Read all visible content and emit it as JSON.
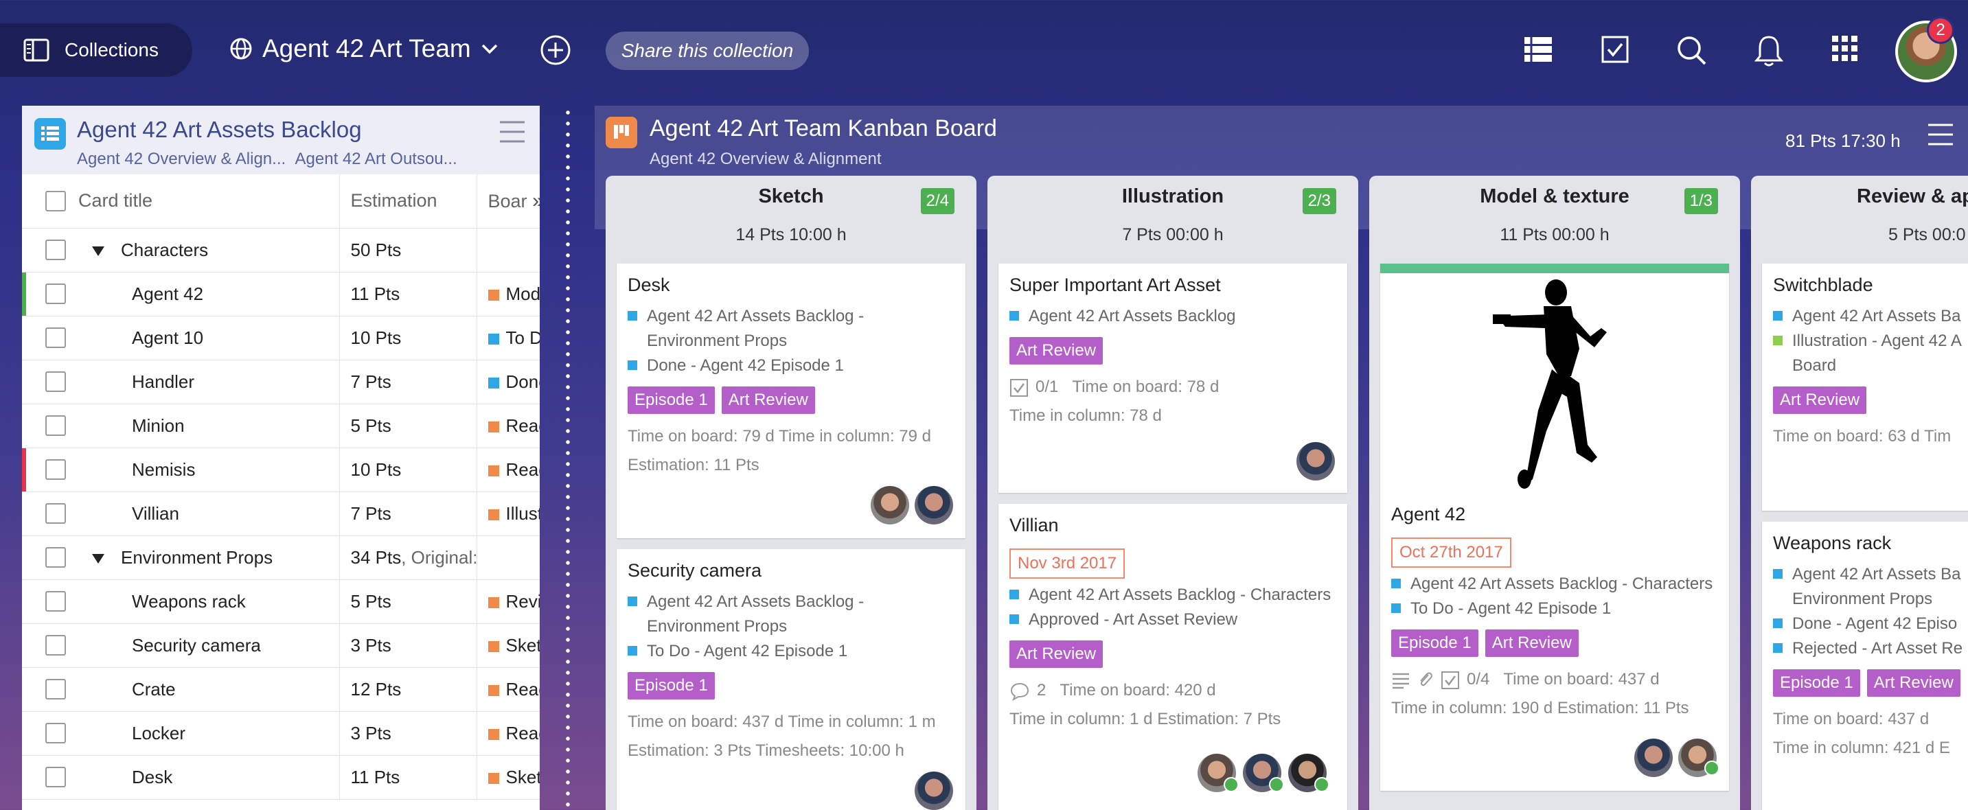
{
  "topbar": {
    "collections_label": "Collections",
    "team_name": "Agent 42 Art Team",
    "share_label": "Share this collection",
    "notification_count": "2",
    "icons": [
      "list-view-icon",
      "checklist-icon",
      "search-icon",
      "bell-icon",
      "apps-grid-icon"
    ]
  },
  "backlog": {
    "title": "Agent 42 Art Assets Backlog",
    "subtitle_1": "Agent 42 Overview & Align...",
    "subtitle_2": "Agent 42 Art Outsou...",
    "columns": {
      "title": "Card title",
      "estimation": "Estimation",
      "board": "Boar"
    },
    "rows": [
      {
        "title": "Characters",
        "est": "50 Pts",
        "board": "",
        "group": true,
        "bar": ""
      },
      {
        "title": "Agent 42",
        "est": "11 Pts",
        "board": "Model",
        "color": "#f08a4b",
        "bar": "#4caf50"
      },
      {
        "title": "Agent 10",
        "est": "10 Pts",
        "board": "To Do",
        "color": "#2fa7e6",
        "bar": ""
      },
      {
        "title": "Handler",
        "est": "7 Pts",
        "board": "Done -",
        "color": "#2fa7e6",
        "bar": ""
      },
      {
        "title": "Minion",
        "est": "5 Pts",
        "board": "Ready",
        "color": "#f08a4b",
        "bar": ""
      },
      {
        "title": "Nemisis",
        "est": "10 Pts",
        "board": "Ready",
        "color": "#f08a4b",
        "bar": "#e8334a"
      },
      {
        "title": "Villian",
        "est": "7 Pts",
        "board": "Illustra",
        "color": "#f08a4b",
        "bar": ""
      },
      {
        "title": "Environment Props",
        "est": "34 Pts",
        "est_extra": ", Original:",
        "board": "",
        "group": true,
        "bar": ""
      },
      {
        "title": "Weapons rack",
        "est": "5 Pts",
        "board": "Review",
        "color": "#f08a4b",
        "bar": ""
      },
      {
        "title": "Security camera",
        "est": "3 Pts",
        "board": "Sketch",
        "color": "#f08a4b",
        "bar": ""
      },
      {
        "title": "Crate",
        "est": "12 Pts",
        "board": "Ready",
        "color": "#f08a4b",
        "bar": ""
      },
      {
        "title": "Locker",
        "est": "3 Pts",
        "board": "Ready",
        "color": "#f08a4b",
        "bar": ""
      },
      {
        "title": "Desk",
        "est": "11 Pts",
        "board": "Sketch",
        "color": "#f08a4b",
        "bar": ""
      }
    ]
  },
  "kanban": {
    "title": "Agent 42 Art Team Kanban Board",
    "subtitle": "Agent 42 Overview & Alignment",
    "stats": "81 Pts 17:30 h",
    "columns": [
      {
        "name": "Sketch",
        "badge": "2/4",
        "summary": "14 Pts 10:00 h"
      },
      {
        "name": "Illustration",
        "badge": "2/3",
        "summary": "7 Pts 00:00 h"
      },
      {
        "name": "Model & texture",
        "badge": "1/3",
        "summary": "11 Pts 00:00 h"
      },
      {
        "name": "Review & ap",
        "badge": "",
        "summary": "5 Pts 00:0"
      }
    ],
    "cards": {
      "desk": {
        "title": "Desk",
        "l1": "Agent 42 Art Assets Backlog -",
        "l1b": "Environment Props",
        "l2": "Done - Agent 42 Episode 1",
        "tag1": "Episode 1",
        "tag2": "Art Review",
        "m1": "Time on board: 79 d  Time in column: 79 d",
        "m2": "Estimation: 11 Pts"
      },
      "security": {
        "title": "Security camera",
        "l1": "Agent 42 Art Assets Backlog -",
        "l1b": "Environment Props",
        "l2": "To Do - Agent 42 Episode 1",
        "tag1": "Episode 1",
        "m1": "Time on board: 437 d  Time in column: 1 m",
        "m2": "Estimation: 3 Pts  Timesheets: 10:00 h"
      },
      "superimportant": {
        "title": "Super Important Art Asset",
        "l1": "Agent 42 Art Assets Backlog",
        "tag1": "Art Review",
        "m1_count": "0/1",
        "m1": "Time on board: 78 d",
        "m2": "Time in column: 78 d"
      },
      "villian": {
        "title": "Villian",
        "date": "Nov 3rd 2017",
        "l1": "Agent 42 Art Assets Backlog - Characters",
        "l2": "Approved - Art Asset Review",
        "tag1": "Art Review",
        "comments": "2",
        "m1": "Time on board: 420 d",
        "m2": "Time in column: 1 d   Estimation: 7 Pts"
      },
      "agent42": {
        "title": "Agent 42",
        "date": "Oct 27th 2017",
        "l1": "Agent 42 Art Assets Backlog - Characters",
        "l2": "To Do - Agent 42 Episode 1",
        "tag1": "Episode 1",
        "tag2": "Art Review",
        "m1_count": "0/4",
        "m1": "Time on board: 437 d",
        "m2": "Time in column: 190 d   Estimation: 11 Pts"
      },
      "switchblade": {
        "title": "Switchblade",
        "l1": "Agent 42 Art Assets Ba",
        "l2": "Illustration - Agent 42 A",
        "l2b": "Board",
        "tag1": "Art Review",
        "m1": "Time on board: 63 d   Tim"
      },
      "weaponsrack": {
        "title": "Weapons rack",
        "l1": "Agent 42 Art Assets Ba",
        "l1b": "Environment Props",
        "l2": "Done - Agent 42 Episo",
        "l3": "Rejected - Art Asset Re",
        "tag1": "Episode 1",
        "tag2": "Art Review",
        "m1": "Time on board: 437 d",
        "m2": "Time in column: 421 d   E"
      }
    }
  }
}
